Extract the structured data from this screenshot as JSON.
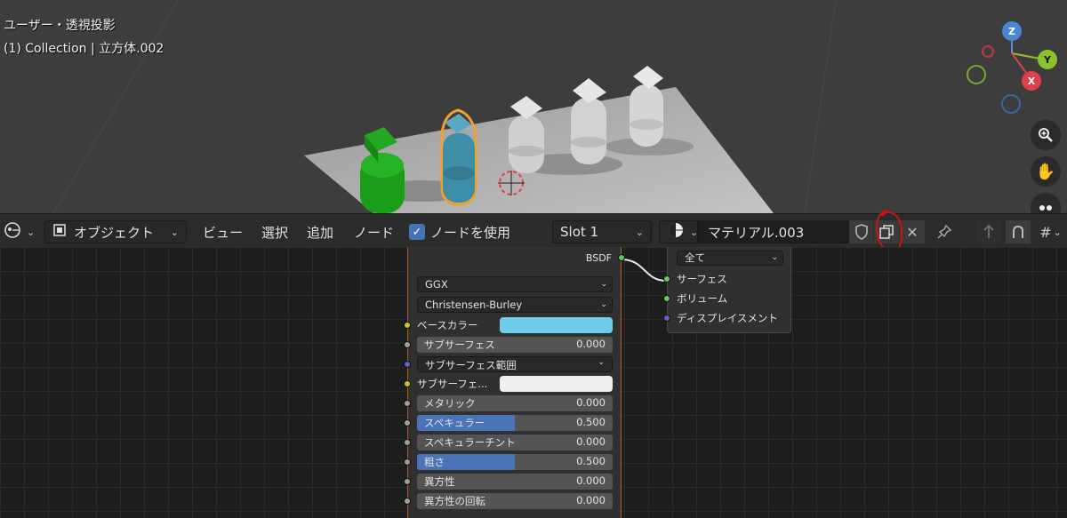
{
  "viewport": {
    "view_name": "ユーザー・透視投影",
    "collection_info": "(1) Collection | 立方体.002",
    "gizmo": {
      "x": "X",
      "y": "Y",
      "z": "Z"
    },
    "nav_icons": [
      "zoom-icon",
      "hand-icon",
      "camera-icon"
    ]
  },
  "header": {
    "editor_type_icon": "node-editor-icon",
    "mode_select": "オブジェクト",
    "menus": [
      "ビュー",
      "選択",
      "追加",
      "ノード"
    ],
    "use_nodes_label": "ノードを使用",
    "use_nodes_checked": true,
    "slot_select": "Slot 1",
    "material_name": "マテリアル.003",
    "icons": [
      "material-sphere-icon",
      "shield-icon",
      "duplicate-icon",
      "close-icon",
      "pin-icon",
      "parent-icon",
      "snap-icon",
      "grid-icon"
    ]
  },
  "bsdf_node": {
    "output_label": "BSDF",
    "distribution": "GGX",
    "subsurface_method": "Christensen-Burley",
    "properties": [
      {
        "label": "ベースカラー",
        "type": "color",
        "color": "#6dcdea",
        "socket": "#c7c729"
      },
      {
        "label": "サブサーフェス",
        "type": "value",
        "value": "0.000",
        "fill": 0,
        "socket": "#a1a1a1"
      },
      {
        "label": "サブサーフェス範囲",
        "type": "dropdown",
        "socket": "#6363c7"
      },
      {
        "label": "サブサーフェ...",
        "type": "color",
        "color": "#eeeeee",
        "socket": "#c7c729"
      },
      {
        "label": "メタリック",
        "type": "value",
        "value": "0.000",
        "fill": 0,
        "socket": "#a1a1a1"
      },
      {
        "label": "スペキュラー",
        "type": "value",
        "value": "0.500",
        "fill": 0.5,
        "socket": "#a1a1a1"
      },
      {
        "label": "スペキュラーチント",
        "type": "value",
        "value": "0.000",
        "fill": 0,
        "socket": "#a1a1a1"
      },
      {
        "label": "粗さ",
        "type": "value",
        "value": "0.500",
        "fill": 0.5,
        "socket": "#a1a1a1"
      },
      {
        "label": "異方性",
        "type": "value",
        "value": "0.000",
        "fill": 0,
        "socket": "#a1a1a1"
      },
      {
        "label": "異方性の回転",
        "type": "value",
        "value": "0.000",
        "fill": 0,
        "socket": "#a1a1a1"
      }
    ]
  },
  "output_node": {
    "target": "全て",
    "inputs": [
      {
        "label": "サーフェス",
        "socket": "#63c763"
      },
      {
        "label": "ボリューム",
        "socket": "#63c763"
      },
      {
        "label": "ディスプレイスメント",
        "socket": "#6363c7"
      }
    ]
  },
  "colors": {
    "accent": "#4772b3",
    "selection_outline": "#f0a030",
    "annotation": "#d01010"
  }
}
